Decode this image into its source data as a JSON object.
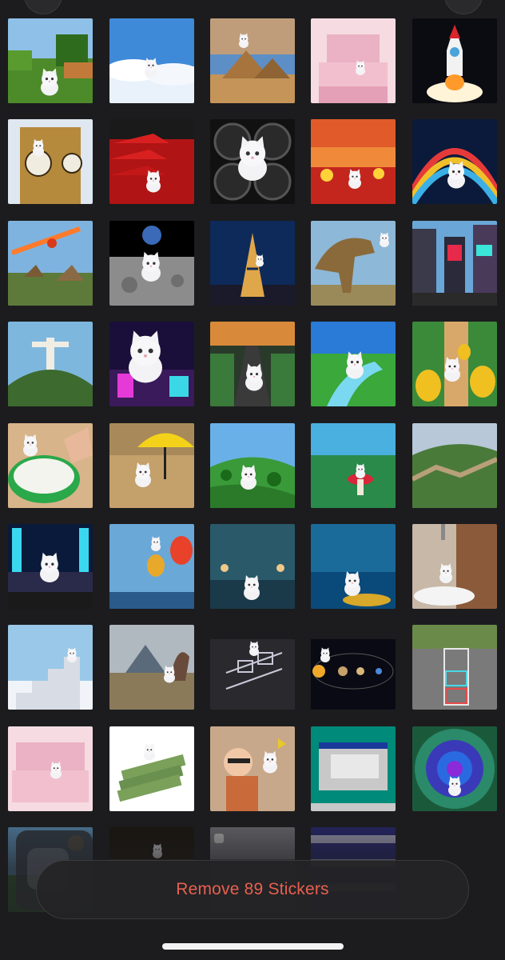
{
  "remove_button": {
    "label": "Remove 89 Stickers"
  },
  "colors": {
    "accent": "#e8604f",
    "background": "#1c1c1e"
  },
  "stickers": [
    {
      "scene": "minecraft-landscape"
    },
    {
      "scene": "clouds-sky"
    },
    {
      "scene": "pyramids"
    },
    {
      "scene": "pink-bedroom"
    },
    {
      "scene": "rocket-launch"
    },
    {
      "scene": "big-ben"
    },
    {
      "scene": "red-pagoda"
    },
    {
      "scene": "speakers"
    },
    {
      "scene": "sunset-field"
    },
    {
      "scene": "rainbow-road"
    },
    {
      "scene": "meteor-dinosaurs"
    },
    {
      "scene": "moon-surface"
    },
    {
      "scene": "eiffel-tower"
    },
    {
      "scene": "t-rex"
    },
    {
      "scene": "times-square"
    },
    {
      "scene": "christ-the-redeemer"
    },
    {
      "scene": "neon-city"
    },
    {
      "scene": "race-track"
    },
    {
      "scene": "river-course"
    },
    {
      "scene": "golden-eggs"
    },
    {
      "scene": "dip-bowl"
    },
    {
      "scene": "yellow-umbrella"
    },
    {
      "scene": "green-hills"
    },
    {
      "scene": "mushroom-land"
    },
    {
      "scene": "great-wall"
    },
    {
      "scene": "concert-stage"
    },
    {
      "scene": "hot-air-balloons"
    },
    {
      "scene": "rainy-street"
    },
    {
      "scene": "ocean-glitter"
    },
    {
      "scene": "shower-bathroom"
    },
    {
      "scene": "stairway-clouds"
    },
    {
      "scene": "dinosaur-lake"
    },
    {
      "scene": "hopscotch-dark"
    },
    {
      "scene": "solar-system"
    },
    {
      "scene": "hopscotch-sidewalk"
    },
    {
      "scene": "pink-bedroom-2"
    },
    {
      "scene": "money-stacks"
    },
    {
      "scene": "butterfly-meme"
    },
    {
      "scene": "windows-setup"
    },
    {
      "scene": "swirl-portal"
    },
    {
      "scene": "blue-sky-partial"
    },
    {
      "scene": "dark-partial"
    },
    {
      "scene": "notification-partial"
    },
    {
      "scene": "pixel-game-partial"
    }
  ]
}
